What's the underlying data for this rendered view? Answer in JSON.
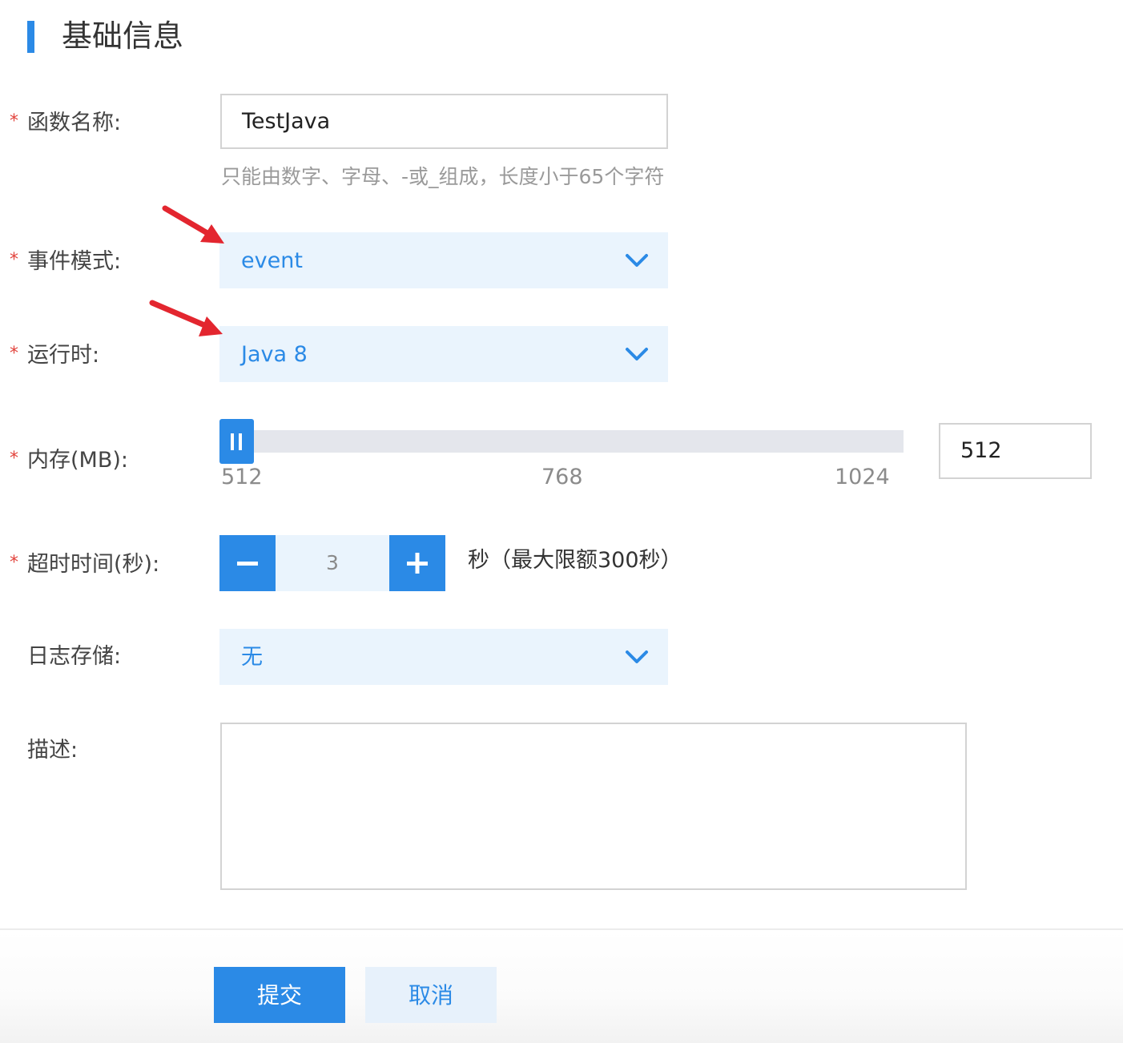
{
  "section": {
    "title": "基础信息"
  },
  "fields": {
    "function_name": {
      "label": "函数名称:",
      "value": "TestJava",
      "hint": "只能由数字、字母、-或_组成，长度小于65个字符",
      "required": true
    },
    "event_mode": {
      "label": "事件模式:",
      "value": "event",
      "required": true
    },
    "runtime": {
      "label": "运行时:",
      "value": "Java 8",
      "required": true
    },
    "memory": {
      "label": "内存(MB):",
      "value": "512",
      "ticks": [
        "512",
        "768",
        "1024"
      ],
      "min": 512,
      "max": 1024,
      "current": 512,
      "required": true
    },
    "timeout": {
      "label": "超时时间(秒):",
      "value": "3",
      "hint": "秒（最大限额300秒）",
      "required": true
    },
    "log_storage": {
      "label": "日志存储:",
      "value": "无",
      "required": false
    },
    "description": {
      "label": "描述:",
      "value": "",
      "required": false
    }
  },
  "required_mark": "*",
  "buttons": {
    "submit": "提交",
    "cancel": "取消"
  },
  "icons": {
    "dropdown": "chevron-down-icon",
    "minus": "minus-icon",
    "plus": "plus-icon",
    "annotation": "red-arrow-annotation"
  },
  "colors": {
    "accent": "#2b8ae6",
    "required": "#e2433c",
    "select_bg": "#eaf4fd",
    "annotation_arrow": "#e3262f"
  }
}
